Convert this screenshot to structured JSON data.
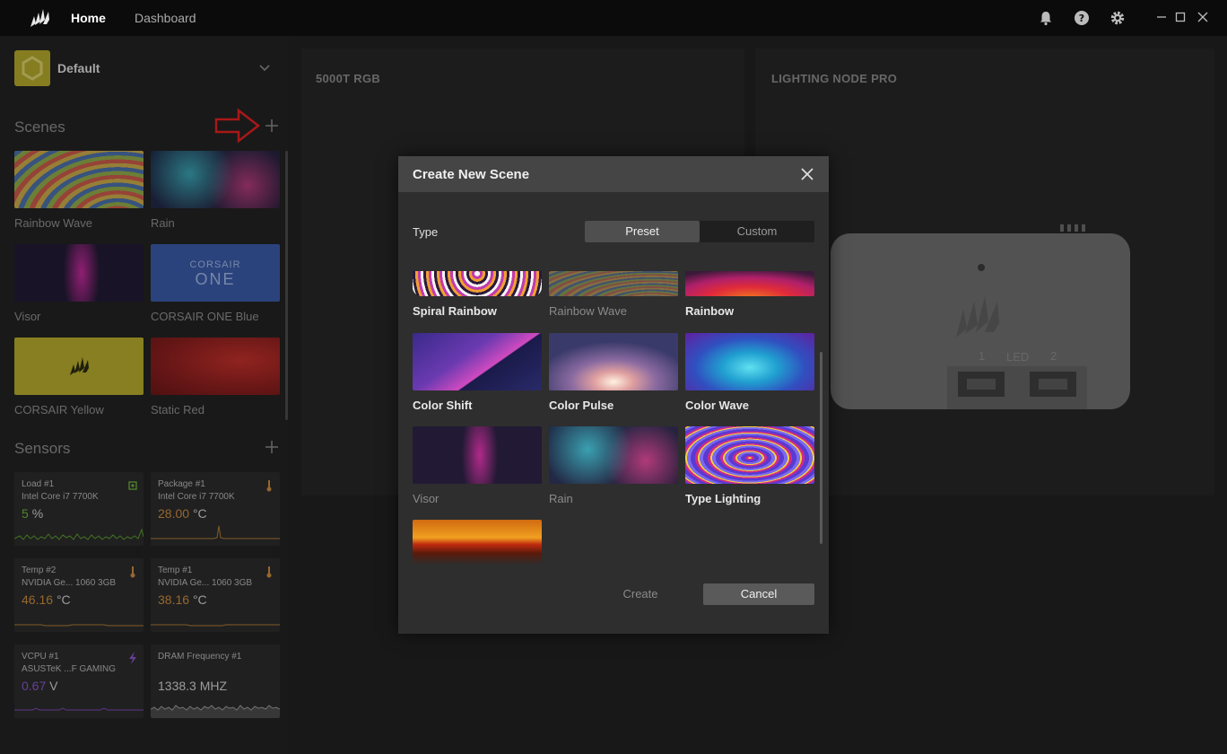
{
  "topbar": {
    "home": "Home",
    "dashboard": "Dashboard",
    "icons": [
      "bell-icon",
      "help-icon",
      "gear-icon"
    ],
    "window_controls": [
      "minimize",
      "maximize",
      "close"
    ]
  },
  "sidebar": {
    "profile": {
      "name": "Default"
    },
    "scenes_title": "Scenes",
    "scenes": [
      {
        "label": "Rainbow Wave"
      },
      {
        "label": "Rain"
      },
      {
        "label": "Visor"
      },
      {
        "label": "CORSAIR ONE Blue",
        "thumb_text": "CORSAIR"
      },
      {
        "label": "CORSAIR Yellow"
      },
      {
        "label": "Static Red"
      }
    ],
    "sensors_title": "Sensors",
    "sensors": [
      {
        "name": "Load #1",
        "source": "Intel Core i7 7700K",
        "value": "5",
        "unit": "%",
        "color": "#6bb33a"
      },
      {
        "name": "Package #1",
        "source": "Intel Core i7 7700K",
        "value": "28.00",
        "unit": "°C",
        "color": "#c98a3e"
      },
      {
        "name": "Temp #2",
        "source": "NVIDIA Ge... 1060 3GB",
        "value": "46.16",
        "unit": "°C",
        "color": "#c98a3e"
      },
      {
        "name": "Temp #1",
        "source": "NVIDIA Ge... 1060 3GB",
        "value": "38.16",
        "unit": "°C",
        "color": "#c98a3e"
      },
      {
        "name": "VCPU #1",
        "source": "ASUSTeK ...F GAMING",
        "value": "0.67",
        "unit": "V",
        "color": "#8a55c8"
      },
      {
        "name": "DRAM Frequency #1",
        "source": "",
        "value": "1338.3 MHZ",
        "unit": "",
        "color": "#cfcfcf"
      }
    ]
  },
  "main": {
    "panel1_title": "5000T RGB",
    "panel2_title": "LIGHTING NODE PRO",
    "device": {
      "led_label": "LED",
      "port1": "1",
      "port2": "2"
    }
  },
  "modal": {
    "title": "Create New Scene",
    "type_label": "Type",
    "segments": [
      "Preset",
      "Custom"
    ],
    "selected_segment": "Preset",
    "presets": [
      {
        "label": "Spiral Rainbow"
      },
      {
        "label": "Rainbow Wave"
      },
      {
        "label": "Rainbow"
      },
      {
        "label": "Color Shift"
      },
      {
        "label": "Color Pulse"
      },
      {
        "label": "Color Wave"
      },
      {
        "label": "Visor"
      },
      {
        "label": "Rain"
      },
      {
        "label": "Type Lighting"
      }
    ],
    "create_label": "Create",
    "cancel_label": "Cancel"
  }
}
